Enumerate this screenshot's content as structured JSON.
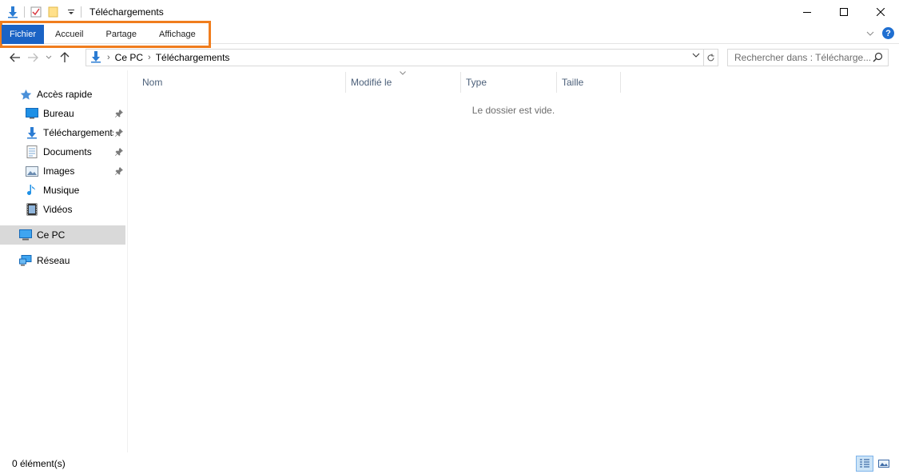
{
  "window": {
    "title": "Téléchargements"
  },
  "ribbon": {
    "tabs": [
      {
        "label": "Fichier",
        "active": true
      },
      {
        "label": "Accueil",
        "active": false
      },
      {
        "label": "Partage",
        "active": false
      },
      {
        "label": "Affichage",
        "active": false
      }
    ],
    "highlight_color": "#f07d1e",
    "active_tab_color": "#1a63c5"
  },
  "address": {
    "segments": [
      "Ce PC",
      "Téléchargements"
    ],
    "search_placeholder": "Rechercher dans : Télécharge..."
  },
  "navpane": {
    "items": [
      {
        "label": "Accès rapide",
        "icon": "star-icon"
      },
      {
        "label": "Bureau",
        "icon": "desktop-icon",
        "pinned": true
      },
      {
        "label": "Téléchargements",
        "icon": "download-icon",
        "pinned": true
      },
      {
        "label": "Documents",
        "icon": "documents-icon",
        "pinned": true
      },
      {
        "label": "Images",
        "icon": "images-icon",
        "pinned": true
      },
      {
        "label": "Musique",
        "icon": "music-icon"
      },
      {
        "label": "Vidéos",
        "icon": "videos-icon"
      },
      {
        "label": "Ce PC",
        "icon": "computer-icon",
        "selected": true
      },
      {
        "label": "Réseau",
        "icon": "network-icon"
      }
    ]
  },
  "content": {
    "columns": [
      "Nom",
      "Modifié le",
      "Type",
      "Taille"
    ],
    "empty_message": "Le dossier est vide."
  },
  "status": {
    "item_count": "0 élément(s)"
  }
}
